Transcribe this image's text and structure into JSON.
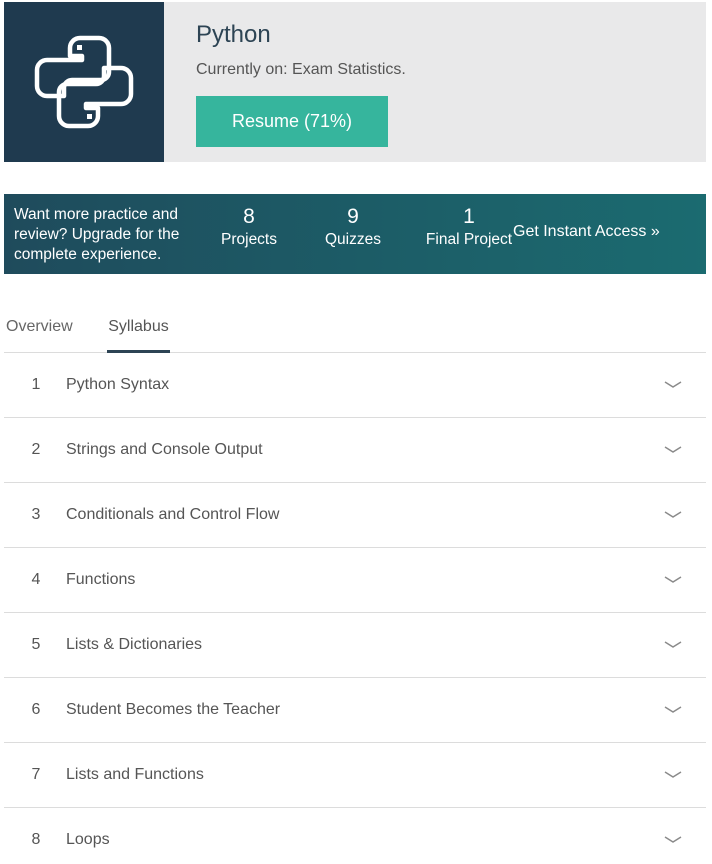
{
  "course": {
    "title": "Python",
    "current": "Currently on: Exam Statistics.",
    "resume_label": "Resume (71%)",
    "logo_icon": "python-logo-icon"
  },
  "banner": {
    "text": "Want more practice and review? Upgrade for the complete experience.",
    "stats": [
      {
        "num": "8",
        "label": "Projects"
      },
      {
        "num": "9",
        "label": "Quizzes"
      },
      {
        "num": "1",
        "label": "Final Project"
      }
    ],
    "cta": "Get Instant Access »"
  },
  "tabs": [
    {
      "label": "Overview",
      "active": false
    },
    {
      "label": "Syllabus",
      "active": true
    }
  ],
  "syllabus": [
    {
      "num": "1",
      "title": "Python Syntax"
    },
    {
      "num": "2",
      "title": "Strings and Console Output"
    },
    {
      "num": "3",
      "title": "Conditionals and Control Flow"
    },
    {
      "num": "4",
      "title": "Functions"
    },
    {
      "num": "5",
      "title": "Lists & Dictionaries"
    },
    {
      "num": "6",
      "title": "Student Becomes the Teacher"
    },
    {
      "num": "7",
      "title": "Lists and Functions"
    },
    {
      "num": "8",
      "title": "Loops"
    }
  ],
  "colors": {
    "logo_bg": "#1f3a4f",
    "accent": "#36b59d",
    "banner_start": "#1f4b5c",
    "banner_end": "#1b6b70"
  }
}
